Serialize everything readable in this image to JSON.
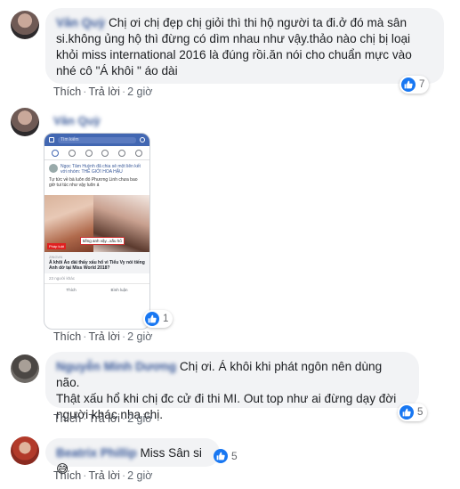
{
  "comments": [
    {
      "author": "Vân Quỳ",
      "text_line1": "Chị ơi chị đẹp chị giỏi thì thi hộ người ta đi.ở đó mà sân",
      "text_line2": "si.không ủng hộ thì đừng có dìm nhau như vậy.thảo nào chị bị loại",
      "text_line3": "khỏi miss international 2016 là đúng rồi.ăn nói cho chuẩn mực vào",
      "text_line4": "nhé cô \"Á khôi \" áo dài",
      "actions": {
        "like": "Thích",
        "reply": "Trả lời",
        "time": "2 giờ"
      },
      "reaction_count": "7"
    },
    {
      "author": "Vân Quỳ",
      "actions": {
        "like": "Thích",
        "reply": "Trả lời",
        "time": "2 giờ"
      },
      "reaction_count": "1",
      "embedded": {
        "search": "Tìm kiếm",
        "post_header": "Ngọc Tâm Huỳnh đã chia sẻ một liên kết với nhóm: THẾ GIỚI HOA HẬU",
        "caption": "Tự tức về bà luôn đó Phương Linh chưa bao giờ tui túc như vậy luôn á",
        "image_tag": "Pháp luật",
        "image_quote": "tiếng anh vậy...xấu hổ",
        "link_source": "ZINGVN",
        "link_title": "Á khôi Áo dài thấy xấu hổ vì Tiểu Vy nói tiếng Anh dở tại Miss World 2018?",
        "meta": "23 người khác",
        "bar_like": "Thích",
        "bar_comment": "Bình luận"
      }
    },
    {
      "author": "Nguyễn Minh Dương",
      "text_line1": "Chị ơi. Á khôi khi phát ngôn nên dùng não.",
      "text_line2": "Thật xấu hổ khi chị đc cử đi thi MI. Out top như ai đừng dạy đời",
      "text_line3": "người khác nha chị.",
      "actions": {
        "like": "Thích",
        "reply": "Trả lời",
        "time": "2 giờ"
      },
      "reaction_count": "5"
    },
    {
      "author": "Beatrix Phillip",
      "text": "Miss Sân si",
      "emoji": "😅",
      "actions": {
        "like": "Thích",
        "reply": "Trả lời",
        "time": "2 giờ"
      },
      "reaction_count": "5"
    }
  ],
  "colors": {
    "like_blue": "#1877f2",
    "name_blue": "#385898",
    "bubble_bg": "#f2f3f5"
  }
}
